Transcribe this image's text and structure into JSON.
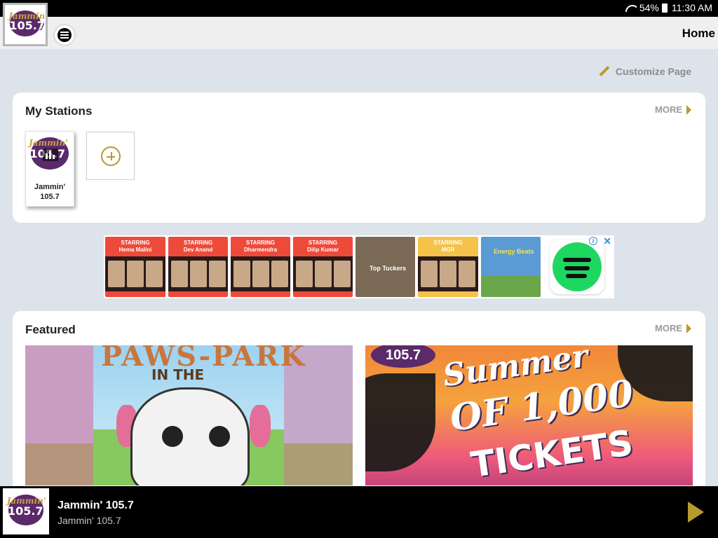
{
  "status_bar": {
    "battery": "54%",
    "time": "11:30 AM"
  },
  "header": {
    "title": "Home",
    "logo_icon": "jammin-105-7-logo-icon",
    "menu_icon": "menu-icon"
  },
  "customize": {
    "label": "Customize Page",
    "icon": "pencil-icon"
  },
  "my_stations": {
    "title": "My Stations",
    "more_label": "MORE",
    "stations": [
      {
        "name": "Jammin' 105.7"
      }
    ],
    "add_icon": "add-circle-icon"
  },
  "ad": {
    "cards": [
      {
        "tag": "STARRING",
        "name": "Hema Malini"
      },
      {
        "tag": "STARRING",
        "name": "Dev Anand"
      },
      {
        "tag": "STARRING",
        "name": "Dharmendra"
      },
      {
        "tag": "STARRING",
        "name": "Dilip Kumar"
      },
      {
        "name": "Top Tuckers"
      },
      {
        "tag": "STARRING",
        "name": "MGR"
      },
      {
        "name": "Energy Beats"
      }
    ],
    "info_label": "i",
    "close_label": "✕"
  },
  "featured": {
    "title": "Featured",
    "more_label": "MORE",
    "items": [
      {
        "line1": "PAWS-PARK",
        "line2": "IN THE"
      },
      {
        "badge": "105.7",
        "line1": "Summer",
        "line2": "OF 1,000",
        "line3": "TICKETS"
      }
    ]
  },
  "now_playing": {
    "title": "Jammin' 105.7",
    "subtitle": "Jammin' 105.7",
    "play_icon": "play-icon"
  },
  "colors": {
    "accent": "#b79a2f",
    "brand_purple": "#5a2a6a",
    "spotify_green": "#1ed760"
  }
}
